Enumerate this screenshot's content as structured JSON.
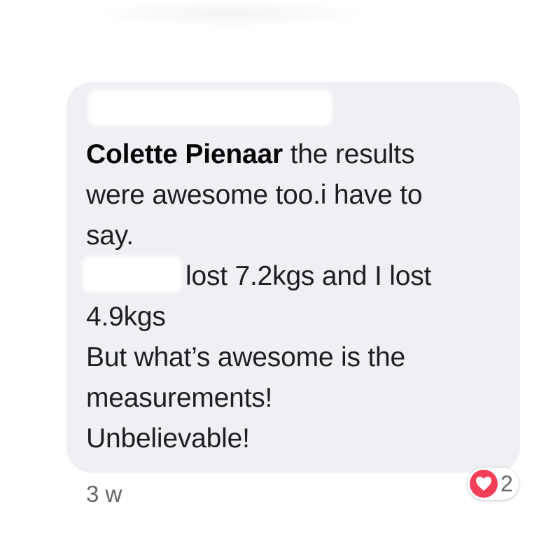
{
  "comment": {
    "author": "Colette Pienaar",
    "text_line1": " the results",
    "text_line2": "were awesome too.i have to",
    "text_line3": "say.",
    "text_line4": "lost 7.2kgs and I lost",
    "text_line5": "4.9kgs",
    "text_line6": "But what’s awesome is the",
    "text_line7": "measurements!",
    "text_line8": "Unbelievable!"
  },
  "meta": {
    "timestamp": "3 w"
  },
  "reactions": {
    "icon": "heart-icon",
    "count": "2"
  },
  "colors": {
    "bubble": "#eff0f4",
    "heart": "#f33e58",
    "muted_text": "#65676b"
  }
}
